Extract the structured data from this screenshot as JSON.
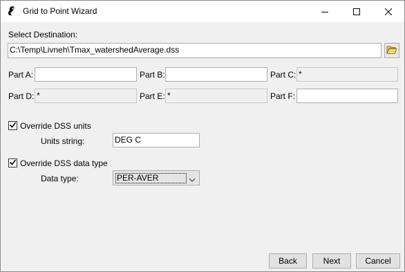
{
  "window": {
    "title": "Grid to Point Wizard",
    "app_icon": "hec-logo-icon",
    "controls": {
      "minimize": "minimize-icon",
      "maximize": "maximize-icon",
      "close": "close-icon"
    }
  },
  "destination": {
    "label": "Select Destination:",
    "path": "C:\\Temp\\Livneh\\Tmax_watershedAverage.dss",
    "browse_icon": "open-folder-icon"
  },
  "parts": {
    "a": {
      "label": "Part A:",
      "value": ""
    },
    "b": {
      "label": "Part B:",
      "value": ""
    },
    "c": {
      "label": "Part C:",
      "value": "*"
    },
    "d": {
      "label": "Part D:",
      "value": "*"
    },
    "e": {
      "label": "Part E:",
      "value": "*"
    },
    "f": {
      "label": "Part F:",
      "value": ""
    }
  },
  "units": {
    "checkbox_label": "Override DSS units",
    "checked": true,
    "string_label": "Units string:",
    "string_value": "DEG C"
  },
  "datatype": {
    "checkbox_label": "Override DSS data type",
    "checked": true,
    "type_label": "Data type:",
    "type_value": "PER-AVER"
  },
  "buttons": {
    "back": "Back",
    "next": "Next",
    "cancel": "Cancel"
  }
}
